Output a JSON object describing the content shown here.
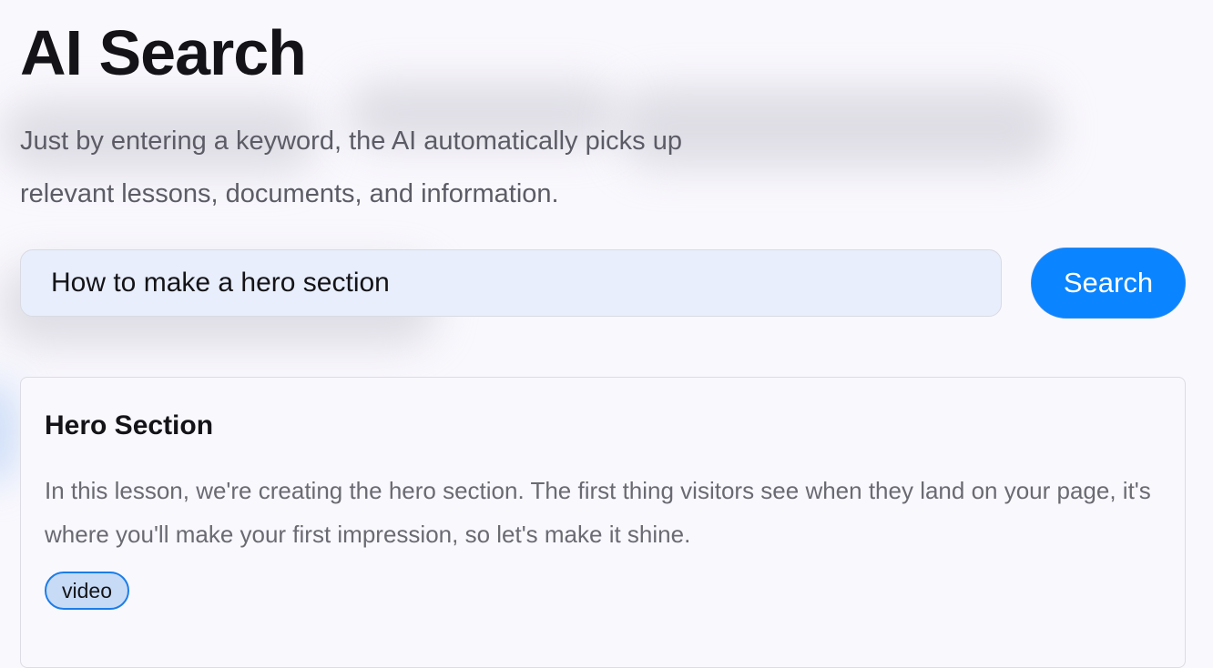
{
  "header": {
    "title": "AI Search",
    "subtitle": "Just by entering a keyword, the AI automatically picks up relevant lessons, documents, and information."
  },
  "search": {
    "value": "How to make a hero section",
    "button_label": "Search"
  },
  "results": [
    {
      "title": "Hero Section",
      "description": "In this lesson, we're creating the hero section. The first thing visitors see when they land on your page, it's where you'll make your first impression, so let's make it shine.",
      "tag": "video"
    }
  ],
  "colors": {
    "background": "#f9f8fd",
    "accent": "#0a84ff",
    "input_background": "#e8eefb",
    "tag_background": "#c7dbf6"
  }
}
